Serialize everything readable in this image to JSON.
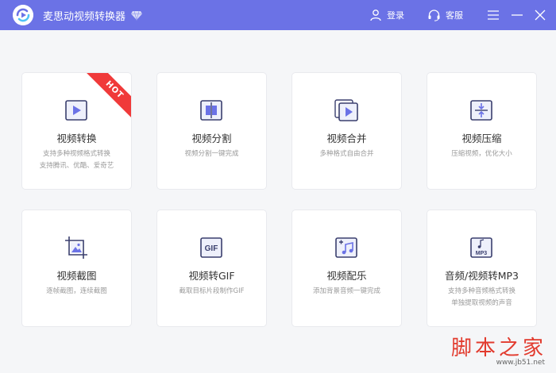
{
  "app": {
    "title": "麦思动视频转换器"
  },
  "header": {
    "login_label": "登录",
    "service_label": "客服"
  },
  "cards": [
    {
      "name": "视频转换",
      "desc1": "支持多种视频格式转换",
      "desc2": "支持腾讯、优酷、爱奇艺",
      "badge": "HOT"
    },
    {
      "name": "视频分割",
      "desc1": "视频分割一键完成",
      "desc2": ""
    },
    {
      "name": "视频合并",
      "desc1": "多种格式自由合并",
      "desc2": ""
    },
    {
      "name": "视频压缩",
      "desc1": "压缩视频，优化大小",
      "desc2": ""
    },
    {
      "name": "视频截图",
      "desc1": "逐帧截图，连续截图",
      "desc2": ""
    },
    {
      "name": "视频转GIF",
      "desc1": "截取目标片段制作GIF",
      "desc2": "",
      "icon_text": "GIF"
    },
    {
      "name": "视频配乐",
      "desc1": "添加背景音频一键完成",
      "desc2": ""
    },
    {
      "name": "音频/视频转MP3",
      "desc1": "支持多种音频格式转换",
      "desc2": "单独提取视频的声音",
      "icon_text": "MP3"
    }
  ],
  "watermark": {
    "main": "脚本之家",
    "sub": "www.jb51.net"
  },
  "colors": {
    "titlebar": "#6b72e6",
    "accent": "#6b72e6",
    "hot": "#f03a3a"
  }
}
